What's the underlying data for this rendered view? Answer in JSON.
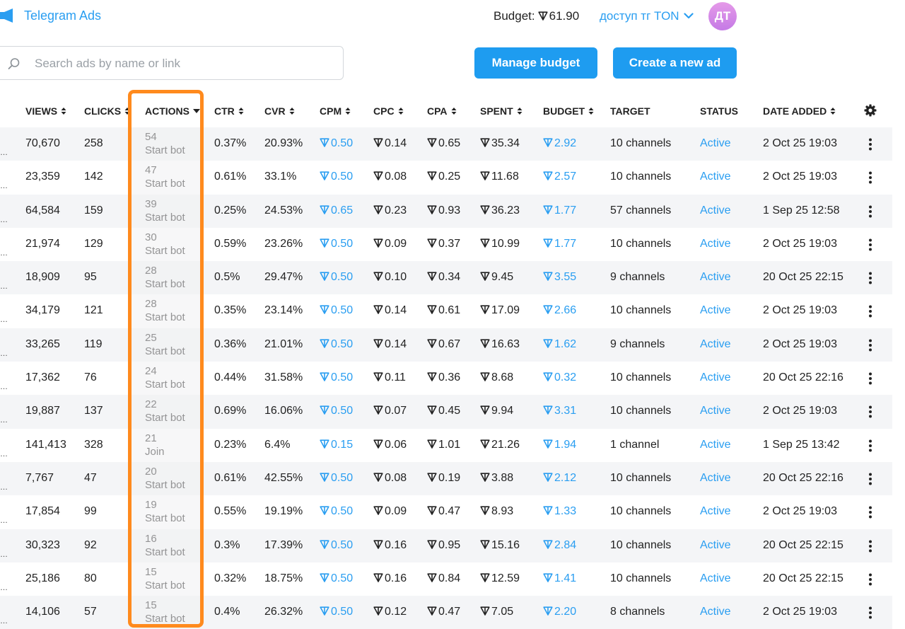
{
  "app": {
    "title": "Telegram Ads",
    "accent": "#2a9ef1",
    "highlight_color": "#ff8a1d"
  },
  "header": {
    "budget_label": "Budget:",
    "budget_value": "61.90",
    "account_name": "доступ тг TON",
    "avatar_initials": "ДТ"
  },
  "search": {
    "placeholder": "Search ads by name or link",
    "value": ""
  },
  "buttons": {
    "manage_budget": "Manage budget",
    "create_ad": "Create a new ad"
  },
  "columns": {
    "views": "VIEWS",
    "clicks": "CLICKS",
    "actions": "ACTIONS",
    "ctr": "CTR",
    "cvr": "CVR",
    "cpm": "CPM",
    "cpc": "CPC",
    "cpa": "CPA",
    "spent": "SPENT",
    "budget": "BUDGET",
    "target": "TARGET",
    "status": "STATUS",
    "date_added": "DATE ADDED"
  },
  "rows": [
    {
      "views": "70,670",
      "clicks": "258",
      "actions": "54",
      "action_type": "Start bot",
      "ctr": "0.37%",
      "cvr": "20.93%",
      "cpm": "0.50",
      "cpc": "0.14",
      "cpa": "0.65",
      "spent": "35.34",
      "budget": "2.92",
      "target": "10 channels",
      "status": "Active",
      "date": "2 Oct 25 19:03"
    },
    {
      "views": "23,359",
      "clicks": "142",
      "actions": "47",
      "action_type": "Start bot",
      "ctr": "0.61%",
      "cvr": "33.1%",
      "cpm": "0.50",
      "cpc": "0.08",
      "cpa": "0.25",
      "spent": "11.68",
      "budget": "2.57",
      "target": "10 channels",
      "status": "Active",
      "date": "2 Oct 25 19:03"
    },
    {
      "views": "64,584",
      "clicks": "159",
      "actions": "39",
      "action_type": "Start bot",
      "ctr": "0.25%",
      "cvr": "24.53%",
      "cpm": "0.65",
      "cpc": "0.23",
      "cpa": "0.93",
      "spent": "36.23",
      "budget": "1.77",
      "target": "57 channels",
      "status": "Active",
      "date": "1 Sep 25 12:58"
    },
    {
      "views": "21,974",
      "clicks": "129",
      "actions": "30",
      "action_type": "Start bot",
      "ctr": "0.59%",
      "cvr": "23.26%",
      "cpm": "0.50",
      "cpc": "0.09",
      "cpa": "0.37",
      "spent": "10.99",
      "budget": "1.77",
      "target": "10 channels",
      "status": "Active",
      "date": "2 Oct 25 19:03"
    },
    {
      "views": "18,909",
      "clicks": "95",
      "actions": "28",
      "action_type": "Start bot",
      "ctr": "0.5%",
      "cvr": "29.47%",
      "cpm": "0.50",
      "cpc": "0.10",
      "cpa": "0.34",
      "spent": "9.45",
      "budget": "3.55",
      "target": "9 channels",
      "status": "Active",
      "date": "20 Oct 25 22:15"
    },
    {
      "views": "34,179",
      "clicks": "121",
      "actions": "28",
      "action_type": "Start bot",
      "ctr": "0.35%",
      "cvr": "23.14%",
      "cpm": "0.50",
      "cpc": "0.14",
      "cpa": "0.61",
      "spent": "17.09",
      "budget": "2.66",
      "target": "10 channels",
      "status": "Active",
      "date": "2 Oct 25 19:03"
    },
    {
      "views": "33,265",
      "clicks": "119",
      "actions": "25",
      "action_type": "Start bot",
      "ctr": "0.36%",
      "cvr": "21.01%",
      "cpm": "0.50",
      "cpc": "0.14",
      "cpa": "0.67",
      "spent": "16.63",
      "budget": "1.62",
      "target": "9 channels",
      "status": "Active",
      "date": "2 Oct 25 19:03"
    },
    {
      "views": "17,362",
      "clicks": "76",
      "actions": "24",
      "action_type": "Start bot",
      "ctr": "0.44%",
      "cvr": "31.58%",
      "cpm": "0.50",
      "cpc": "0.11",
      "cpa": "0.36",
      "spent": "8.68",
      "budget": "0.32",
      "target": "10 channels",
      "status": "Active",
      "date": "20 Oct 25 22:16"
    },
    {
      "views": "19,887",
      "clicks": "137",
      "actions": "22",
      "action_type": "Start bot",
      "ctr": "0.69%",
      "cvr": "16.06%",
      "cpm": "0.50",
      "cpc": "0.07",
      "cpa": "0.45",
      "spent": "9.94",
      "budget": "3.31",
      "target": "10 channels",
      "status": "Active",
      "date": "2 Oct 25 19:03"
    },
    {
      "views": "141,413",
      "clicks": "328",
      "actions": "21",
      "action_type": "Join",
      "ctr": "0.23%",
      "cvr": "6.4%",
      "cpm": "0.15",
      "cpc": "0.06",
      "cpa": "1.01",
      "spent": "21.26",
      "budget": "1.94",
      "target": "1 channel",
      "status": "Active",
      "date": "1 Sep 25 13:42"
    },
    {
      "views": "7,767",
      "clicks": "47",
      "actions": "20",
      "action_type": "Start bot",
      "ctr": "0.61%",
      "cvr": "42.55%",
      "cpm": "0.50",
      "cpc": "0.08",
      "cpa": "0.19",
      "spent": "3.88",
      "budget": "2.12",
      "target": "10 channels",
      "status": "Active",
      "date": "20 Oct 25 22:16"
    },
    {
      "views": "17,854",
      "clicks": "99",
      "actions": "19",
      "action_type": "Start bot",
      "ctr": "0.55%",
      "cvr": "19.19%",
      "cpm": "0.50",
      "cpc": "0.09",
      "cpa": "0.47",
      "spent": "8.93",
      "budget": "1.33",
      "target": "10 channels",
      "status": "Active",
      "date": "2 Oct 25 19:03"
    },
    {
      "views": "30,323",
      "clicks": "92",
      "actions": "16",
      "action_type": "Start bot",
      "ctr": "0.3%",
      "cvr": "17.39%",
      "cpm": "0.50",
      "cpc": "0.16",
      "cpa": "0.95",
      "spent": "15.16",
      "budget": "2.84",
      "target": "10 channels",
      "status": "Active",
      "date": "20 Oct 25 22:15"
    },
    {
      "views": "25,186",
      "clicks": "80",
      "actions": "15",
      "action_type": "Start bot",
      "ctr": "0.32%",
      "cvr": "18.75%",
      "cpm": "0.50",
      "cpc": "0.16",
      "cpa": "0.84",
      "spent": "12.59",
      "budget": "1.41",
      "target": "10 channels",
      "status": "Active",
      "date": "20 Oct 25 22:15"
    },
    {
      "views": "14,106",
      "clicks": "57",
      "actions": "15",
      "action_type": "Start bot",
      "ctr": "0.4%",
      "cvr": "26.32%",
      "cpm": "0.50",
      "cpc": "0.12",
      "cpa": "0.47",
      "spent": "7.05",
      "budget": "2.20",
      "target": "8 channels",
      "status": "Active",
      "date": "2 Oct 25 19:03"
    }
  ]
}
